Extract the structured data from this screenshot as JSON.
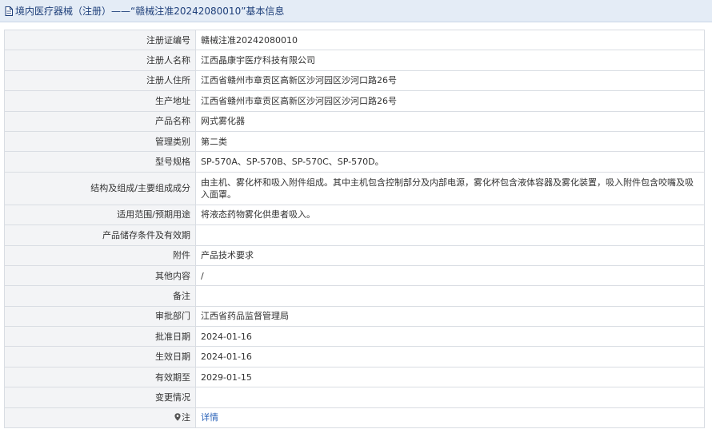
{
  "header": {
    "title": "境内医疗器械（注册）——“赣械注准20242080010”基本信息"
  },
  "rows": [
    {
      "label": "注册证编号",
      "value": "赣械注准20242080010"
    },
    {
      "label": "注册人名称",
      "value": "江西晶康宇医疗科技有限公司"
    },
    {
      "label": "注册人住所",
      "value": "江西省赣州市章贡区高新区沙河园区沙河口路26号"
    },
    {
      "label": "生产地址",
      "value": "江西省赣州市章贡区高新区沙河园区沙河口路26号"
    },
    {
      "label": "产品名称",
      "value": "网式雾化器"
    },
    {
      "label": "管理类别",
      "value": "第二类"
    },
    {
      "label": "型号规格",
      "value": "SP-570A、SP-570B、SP-570C、SP-570D。"
    },
    {
      "label": "结构及组成/主要组成成分",
      "value": "由主机、雾化杯和吸入附件组成。其中主机包含控制部分及内部电源，雾化杯包含液体容器及雾化装置，吸入附件包含咬嘴及吸入面罩。"
    },
    {
      "label": "适用范围/预期用途",
      "value": "将液态药物雾化供患者吸入。"
    },
    {
      "label": "产品储存条件及有效期",
      "value": ""
    },
    {
      "label": "附件",
      "value": "产品技术要求"
    },
    {
      "label": "其他内容",
      "value": "/"
    },
    {
      "label": "备注",
      "value": ""
    },
    {
      "label": "审批部门",
      "value": "江西省药品监督管理局"
    },
    {
      "label": "批准日期",
      "value": "2024-01-16"
    },
    {
      "label": "生效日期",
      "value": "2024-01-16"
    },
    {
      "label": "有效期至",
      "value": "2029-01-15"
    },
    {
      "label": "变更情况",
      "value": ""
    }
  ],
  "note": {
    "icon": "pin-icon",
    "label": "注",
    "link_text": "详情"
  },
  "colors": {
    "header_bg": "#e4ecf6",
    "header_text": "#1e3f7a",
    "label_bg": "#f3f4f6",
    "link": "#2a62b8"
  }
}
